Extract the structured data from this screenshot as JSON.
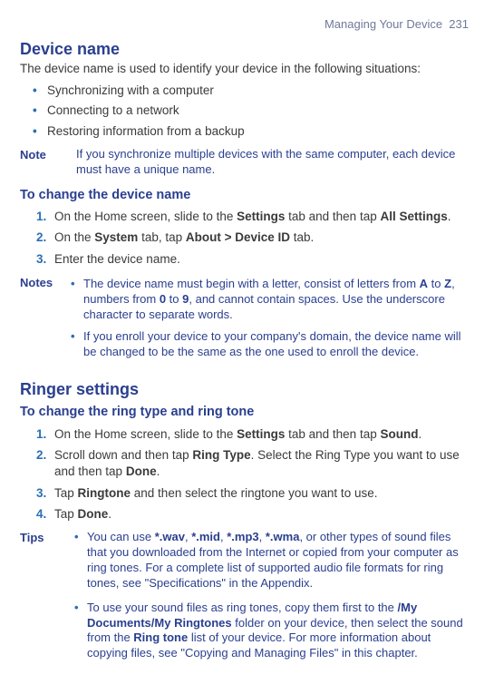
{
  "header": {
    "chapter": "Managing Your Device",
    "page": "231"
  },
  "s1": {
    "title": "Device name",
    "intro": "The device name is used to identify your device in the following situations:",
    "bullets": [
      "Synchronizing with a computer",
      "Connecting to a network",
      "Restoring information from a backup"
    ],
    "note_label": "Note",
    "note_body": "If you synchronize multiple devices with the same computer, each device must have a unique name.",
    "sub1": {
      "title": "To change the device name",
      "steps": {
        "s1a": "On the Home screen, slide to the ",
        "s1b": "Settings",
        "s1c": " tab and then tap ",
        "s1d": "All Settings",
        "s1e": ".",
        "s2a": "On the ",
        "s2b": "System",
        "s2c": " tab, tap ",
        "s2d": "About > Device ID",
        "s2e": " tab.",
        "s3": "Enter the device name."
      },
      "notes_label": "Notes",
      "notes": {
        "n1a": "The device name must begin with a letter, consist of letters from ",
        "n1b": "A",
        "n1c": " to ",
        "n1d": "Z",
        "n1e": ", numbers from ",
        "n1f": "0",
        "n1g": " to ",
        "n1h": "9",
        "n1i": ", and cannot contain spaces. Use the underscore character to separate words.",
        "n2": "If you enroll your device to your company's domain, the device name will be changed to be the same as the one used to enroll the device."
      }
    }
  },
  "s2": {
    "title": "Ringer settings",
    "sub1": {
      "title": "To change the ring type and ring tone",
      "steps": {
        "s1a": "On the Home screen, slide to the ",
        "s1b": "Settings",
        "s1c": " tab and then tap ",
        "s1d": "Sound",
        "s1e": ".",
        "s2a": "Scroll down and then tap ",
        "s2b": "Ring Type",
        "s2c": ". Select the Ring Type you want to use and then tap ",
        "s2d": "Done",
        "s2e": ".",
        "s3a": "Tap ",
        "s3b": "Ringtone",
        "s3c": " and then select the ringtone you want to use.",
        "s4a": "Tap ",
        "s4b": "Done",
        "s4c": "."
      },
      "tips_label": "Tips",
      "tips": {
        "t1a": "You can use ",
        "t1b": "*.wav",
        "t1c": ", ",
        "t1d": "*.mid",
        "t1e": ", ",
        "t1f": "*.mp3",
        "t1g": ", ",
        "t1h": "*.wma",
        "t1i": ", or other types of sound files that you downloaded from the Internet or copied from your computer as ring tones. For a complete list of supported audio file formats for ring tones, see \"Specifications\" in the Appendix.",
        "t2a": "To use your sound files as ring tones, copy them first to the ",
        "t2b": "/My Documents/My Ringtones",
        "t2c": " folder on your device, then select the sound from the ",
        "t2d": "Ring tone",
        "t2e": " list of your device. For more information about copying files, see \"Copying and Managing Files\" in this chapter."
      }
    }
  }
}
